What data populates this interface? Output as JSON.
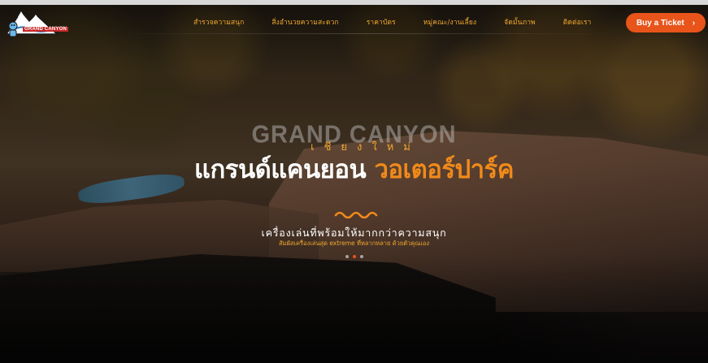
{
  "brand": {
    "logo_alt": "GRAND CANYON WATER PARK logo",
    "logo_text": "GRAND CANYON"
  },
  "nav": {
    "items": [
      {
        "label": "สำรวจความสนุก"
      },
      {
        "label": "สิ่งอำนวยความสะดวก"
      },
      {
        "label": "ราคาบัตร"
      },
      {
        "label": "หมู่คณะ/งานเลี้ยง"
      },
      {
        "label": "จัดมั้นภาพ"
      },
      {
        "label": "ติดต่อเรา"
      }
    ]
  },
  "cta": {
    "label": "Buy a Ticket",
    "chevron": "›",
    "color": "#e8541a"
  },
  "hero": {
    "bg_word": "GRAND CANYON",
    "city": "เชียงใหม่",
    "title_white": "แกรนด์แคนยอน",
    "title_orange": "วอเตอร์ปาร์ค",
    "tagline": "เครื่องเล่นที่พร้อมให้มากกว่าความสนุก",
    "tagline_sub": "สัมผัสเครื่องเล่นสุด extreme ที่หลากหลาย ด้วยตัวคุณเอง",
    "accent_color": "#f08a1a",
    "slide_count": 3,
    "active_slide": 2
  }
}
